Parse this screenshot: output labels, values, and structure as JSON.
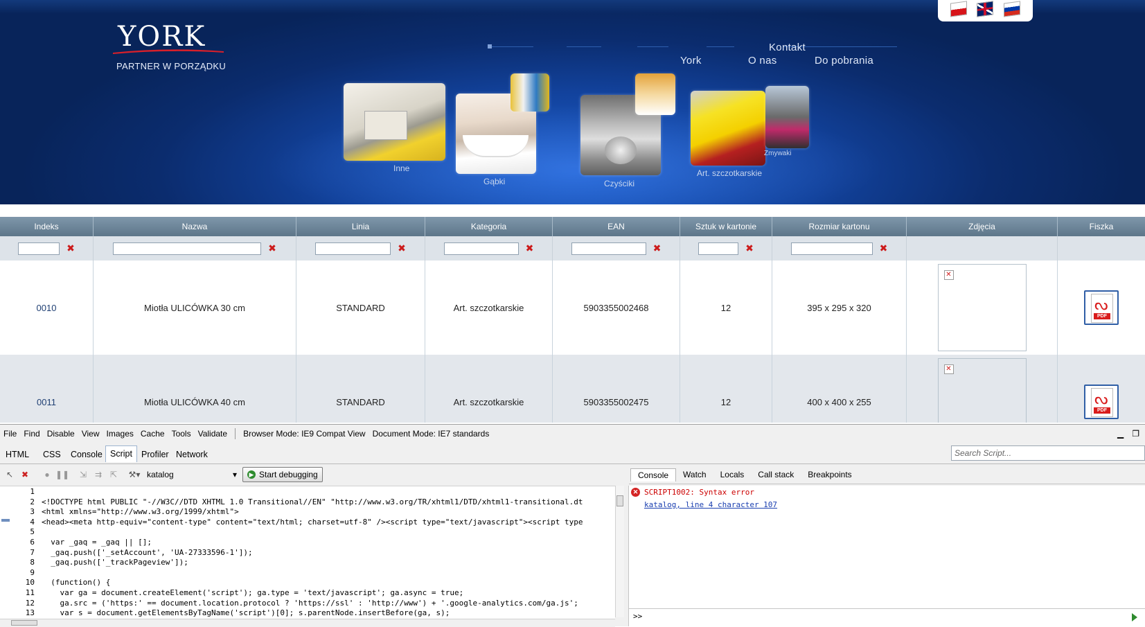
{
  "header": {
    "logo_text": "YORK",
    "tagline": "PARTNER W PORZĄDKU",
    "nav": [
      "Kontakt",
      "York",
      "O nas",
      "Do pobrania"
    ],
    "categories": [
      "Inne",
      "Gąbki",
      "Czyściki",
      "Art. szczotkarskie",
      "Zmywaki"
    ]
  },
  "table": {
    "columns": [
      "Indeks",
      "Nazwa",
      "Linia",
      "Kategoria",
      "EAN",
      "Sztuk w kartonie",
      "Rozmiar kartonu",
      "Zdjęcia",
      "Fiszka"
    ],
    "clear_icon": "✖",
    "rows": [
      {
        "indeks": "0010",
        "nazwa": "Miotła ULICÓWKA 30 cm",
        "linia": "STANDARD",
        "kategoria": "Art. szczotkarskie",
        "ean": "5903355002468",
        "sztuk": "12",
        "rozmiar": "395 x 295 x 320"
      },
      {
        "indeks": "0011",
        "nazwa": "Miotła ULICÓWKA 40 cm",
        "linia": "STANDARD",
        "kategoria": "Art. szczotkarskie",
        "ean": "5903355002475",
        "sztuk": "12",
        "rozmiar": "400 x 400 x 255"
      }
    ],
    "pdf_label": "PDF"
  },
  "devtools": {
    "menu": [
      "File",
      "Find",
      "Disable",
      "View",
      "Images",
      "Cache",
      "Tools",
      "Validate"
    ],
    "browser_mode": "Browser Mode: IE9 Compat View",
    "document_mode": "Document Mode: IE7 standards",
    "tabs": [
      "HTML",
      "CSS",
      "Console",
      "Script",
      "Profiler",
      "Network"
    ],
    "active_tab": "Script",
    "search_placeholder": "Search Script...",
    "script_select": "katalog",
    "start_debugging": "Start debugging",
    "right_tabs": [
      "Console",
      "Watch",
      "Locals",
      "Call stack",
      "Breakpoints"
    ],
    "code_lines": [
      "",
      "<!DOCTYPE html PUBLIC \"-//W3C//DTD XHTML 1.0 Transitional//EN\" \"http://www.w3.org/TR/xhtml1/DTD/xhtml1-transitional.dt",
      "<html xmlns=\"http://www.w3.org/1999/xhtml\">",
      "<head><meta http-equiv=\"content-type\" content=\"text/html; charset=utf-8\" /><script type=\"text/javascript\"><script type",
      "",
      "  var _gaq = _gaq || [];",
      "  _gaq.push(['_setAccount', 'UA-27333596-1']);",
      "  _gaq.push(['_trackPageview']);",
      "",
      "  (function() {",
      "    var ga = document.createElement('script'); ga.type = 'text/javascript'; ga.async = true;",
      "    ga.src = ('https:' == document.location.protocol ? 'https://ssl' : 'http://www') + '.google-analytics.com/ga.js';",
      "    var s = document.getElementsByTagName('script')[0]; s.parentNode.insertBefore(ga, s);"
    ],
    "error_title": "SCRIPT1002: Syntax error",
    "error_link": "katalog, line 4 character 107",
    "console_prompt": ">>"
  }
}
